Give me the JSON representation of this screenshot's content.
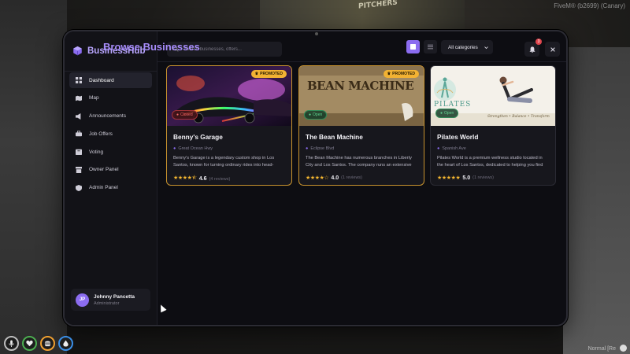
{
  "overlay": {
    "fivem_label": "FiveM® (b2699) (Canary)",
    "sign_text": "PITCHERS",
    "voice_mode": "Normal [Re"
  },
  "app": {
    "name": "BusinessHub",
    "accent": "#8b6cf0",
    "title_color": "#a78cfb"
  },
  "sidebar": {
    "items": [
      {
        "label": "Dashboard",
        "icon": "dashboard-icon"
      },
      {
        "label": "Map",
        "icon": "map-icon"
      },
      {
        "label": "Announcements",
        "icon": "megaphone-icon"
      },
      {
        "label": "Job Offers",
        "icon": "briefcase-icon"
      },
      {
        "label": "Voting",
        "icon": "ballot-icon"
      },
      {
        "label": "Owner Panel",
        "icon": "store-icon"
      },
      {
        "label": "Admin Panel",
        "icon": "shield-icon"
      }
    ],
    "active": "Dashboard",
    "user": {
      "initials": "JP",
      "name": "Johnny Pancetta",
      "role": "Administrator"
    }
  },
  "header": {
    "search_placeholder": "Search businesses, offers...",
    "notifications_count": "3"
  },
  "main": {
    "title": "Browse Businesses",
    "category": "All categories",
    "view_mode": "grid"
  },
  "businesses": [
    {
      "name": "Benny's Garage",
      "location": "Great Ocean Hwy",
      "description": "Benny's Garage is a legendary custom shop in Los Santos, known for turning ordinary rides into head-turning works of art.",
      "rating": "4.6",
      "reviews": "(4 reviews)",
      "status": "Closed",
      "promoted": "PROMOTED",
      "stars": "★★★★⯪"
    },
    {
      "name": "The Bean Machine",
      "location": "Eclipse Blvd",
      "description": "The Bean Machine has numerous branches in Liberty City and Los Santos. The company runs an extensive coffee chain.",
      "rating": "4.0",
      "reviews": "(1 reviews)",
      "status": "Open",
      "promoted": "PROMOTED",
      "stars": "★★★★☆",
      "banner_text": "BEAN MACHINE"
    },
    {
      "name": "Pilates World",
      "location": "Spanish Ave",
      "description": "Pilates World is a premium wellness studio located in the heart of Los Santos, dedicated to helping you find balance.",
      "rating": "5.0",
      "reviews": "(1 reviews)",
      "status": "Open",
      "stars": "★★★★★",
      "banner_text": "PILATES",
      "banner_tagline": "Strengthen • Balance • Transform"
    }
  ]
}
